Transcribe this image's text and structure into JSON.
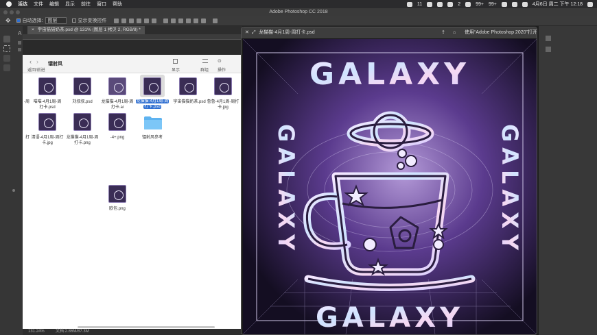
{
  "menubar": {
    "app": "活达",
    "items": [
      "文件",
      "编辑",
      "显示",
      "前往",
      "窗口",
      "帮助"
    ],
    "status": {
      "badge1": "11",
      "badge2": "2",
      "badge3": "99+",
      "badge4": "99+",
      "datetime": "4月6日 周二 下午 12:18"
    }
  },
  "ps": {
    "title": "Adobe Photoshop CC 2018",
    "options": {
      "auto_select_label": "自动选择:",
      "layer_select": "图层",
      "show_transform": "显示变换控件"
    },
    "doc_tab": "宇宙猫猫奶茶.psd @ 131% (图层 1 拷贝 2, RGB/8) *",
    "status_zoom": "131.24%",
    "status_doc": "文档:2.86M/87.3M"
  },
  "finder": {
    "title": "镭射风",
    "back_label": "返回/前进",
    "view_label": "显示",
    "group_label": "群组",
    "action_label": "操作",
    "row1": [
      {
        "name": "喵喵-4月1周-周打卡.psd",
        "l1": "喵喵-4月1周-周",
        "l2": "打卡.psd"
      },
      {
        "name": "刘叔叔.psd",
        "l1": "刘叔叔.psd",
        "l2": ""
      },
      {
        "name": "龙猫猫-4月1周-周打卡.ai",
        "l1": "龙猫猫-4月1周-周",
        "l2": "打卡.ai"
      },
      {
        "name": "龙猫猫-4月1周-周打卡.psd",
        "l1": "龙猫猫-4月1周-周",
        "l2": "打卡.psd"
      },
      {
        "name": "宇宙猫猫奶茶.psd",
        "l1": "宇宙猫猫奶茶.psd",
        "l2": ""
      },
      {
        "name": "鲁鲁-4月1周-周打卡.jpg",
        "l1": "鲁鲁-4月1周-周打",
        "l2": "卡.jpg"
      }
    ],
    "row1_partial": "-周",
    "row2": [
      {
        "name": "清语-4月1周-周打卡.jpg",
        "l1": "清语-4月1周-周打",
        "l2": "卡.jpg"
      },
      {
        "name": "龙猫猫-4月1周-周打卡.png",
        "l1": "龙猫猫-4月1周-周",
        "l2": "打卡.png"
      },
      {
        "name": "-4+.png",
        "l1": "-4+.png",
        "l2": ""
      },
      {
        "name": "镭射风参考",
        "l1": "镭射风参考",
        "l2": ""
      }
    ],
    "row2_partial": "打",
    "loose": {
      "name": "欧包.png",
      "l1": "欧包.png"
    }
  },
  "quicklook": {
    "title": "龙猫猫-4月1周-周打卡.psd",
    "open_with": "使用“Adobe Photoshop 2020”打开"
  },
  "artwork": {
    "word_top": "GALAXY",
    "word_bottom": "GALAXY",
    "word_left": "GALAXY",
    "word_right": "GALAXY"
  },
  "colors": {
    "accent": "#2f6fd1",
    "folder": "#5eb3f0"
  }
}
